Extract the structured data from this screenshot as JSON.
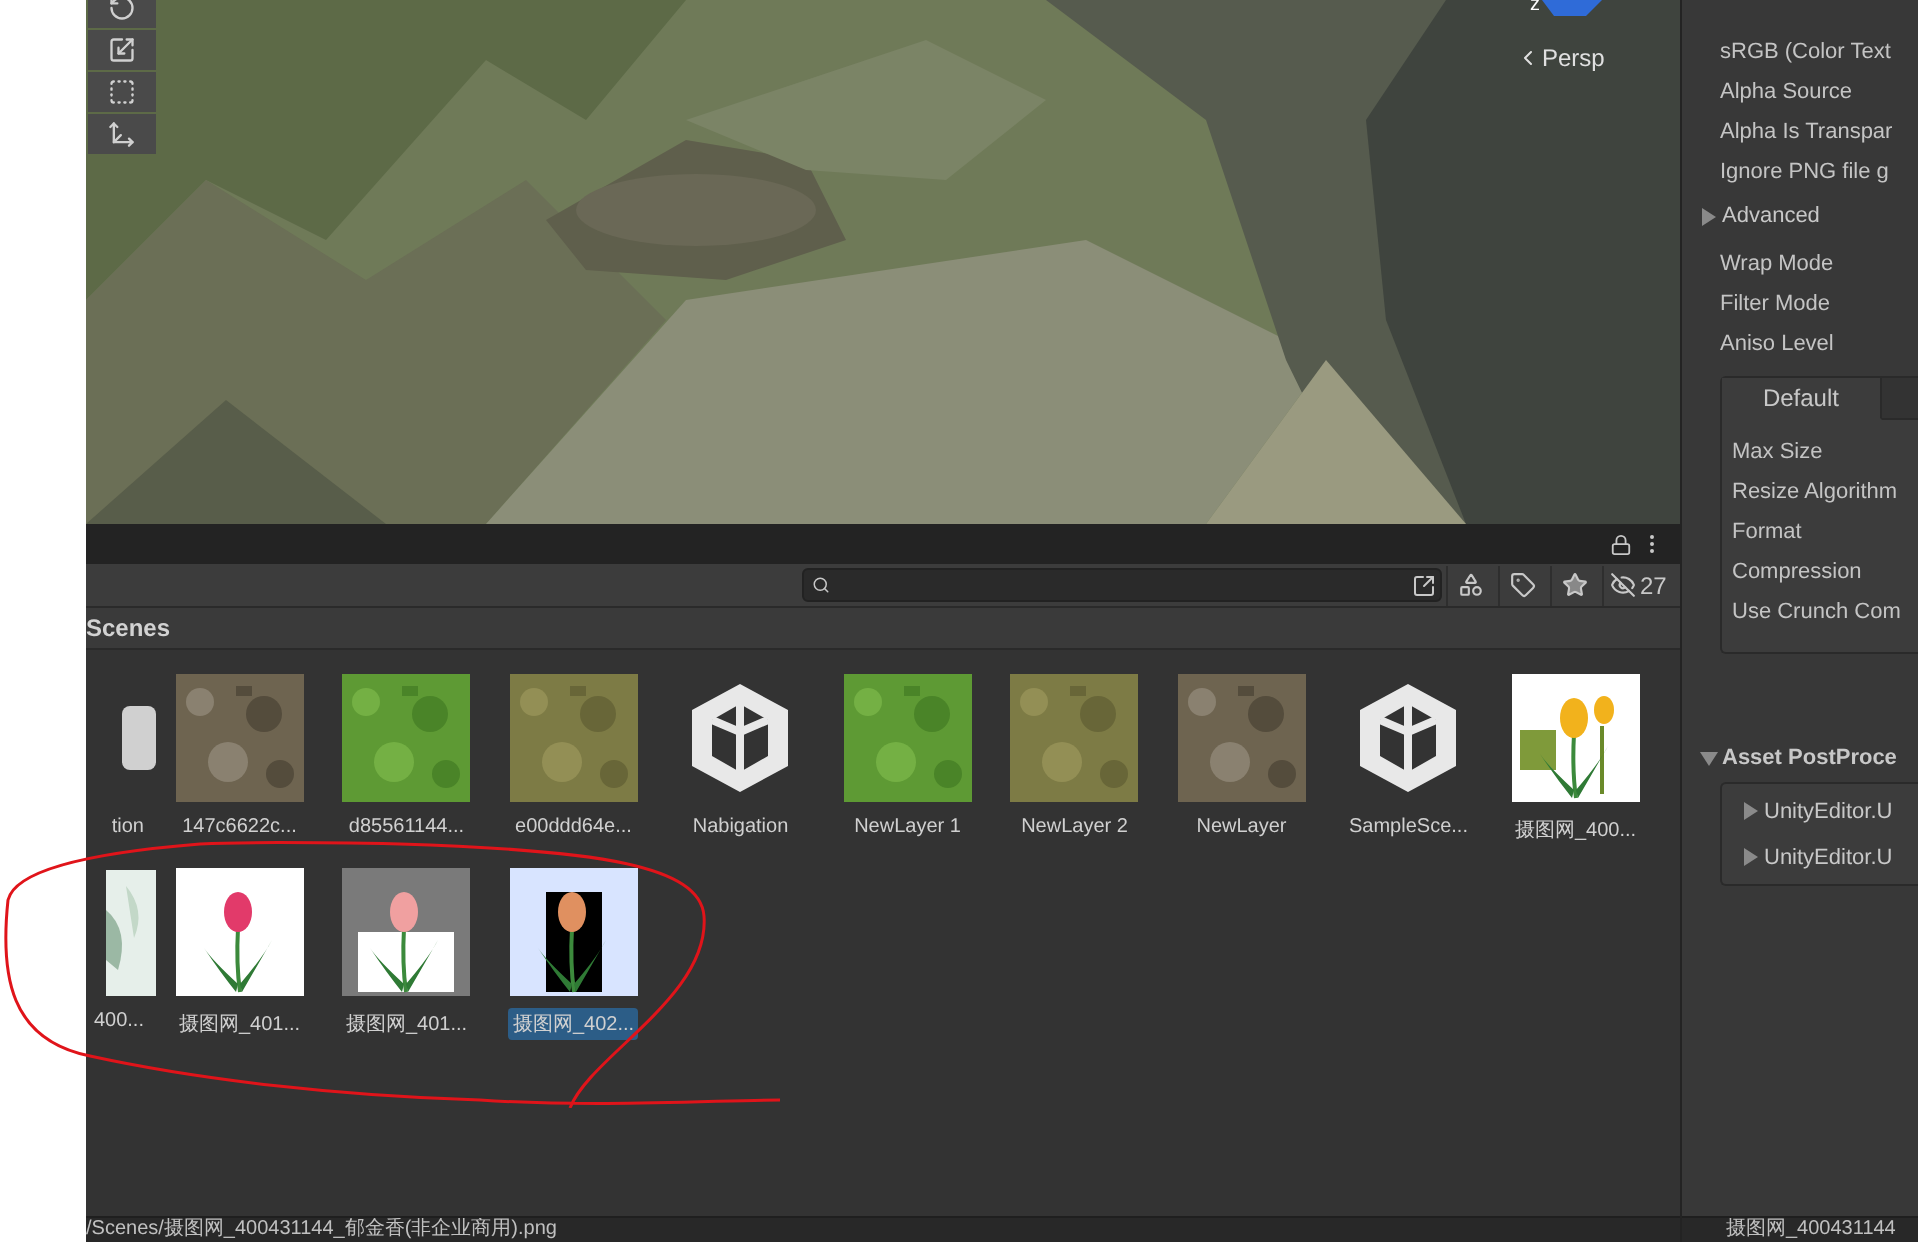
{
  "scene_view": {
    "tools": [
      {
        "kind": "rotate"
      },
      {
        "kind": "scale"
      },
      {
        "kind": "rect"
      },
      {
        "kind": "transform"
      }
    ],
    "gizmo_axis": "z",
    "camera_label": "Persp"
  },
  "project": {
    "hidden_count": "27",
    "breadcrumb": "Scenes",
    "items": [
      {
        "label": "tion",
        "kind": "blank",
        "selected": false
      },
      {
        "label": "147c6622c...",
        "kind": "dirt",
        "selected": false
      },
      {
        "label": "d85561144...",
        "kind": "grass",
        "selected": false
      },
      {
        "label": "e00ddd64e...",
        "kind": "dry",
        "selected": false
      },
      {
        "label": "Nabigation",
        "kind": "unity",
        "selected": false
      },
      {
        "label": "NewLayer 1",
        "kind": "grass",
        "selected": false
      },
      {
        "label": "NewLayer 2",
        "kind": "dry",
        "selected": false
      },
      {
        "label": "NewLayer",
        "kind": "dirt",
        "selected": false
      },
      {
        "label": "SampleSce...",
        "kind": "unity",
        "selected": false
      },
      {
        "label": "摄图网_400...",
        "kind": "tulips-yellow",
        "selected": false
      },
      {
        "label": "400...",
        "kind": "leaves",
        "selected": false
      },
      {
        "label": "摄图网_401...",
        "kind": "tulip-pink",
        "selected": false
      },
      {
        "label": "摄图网_401...",
        "kind": "tulip-gray",
        "selected": false
      },
      {
        "label": "摄图网_402...",
        "kind": "tulips-orange",
        "selected": true
      }
    ],
    "path": "/Scenes/摄图网_400431144_郁金香(非企业商用).png"
  },
  "inspector": {
    "top_rows": [
      "sRGB (Color Text",
      "Alpha Source",
      "Alpha Is Transpar",
      "Ignore PNG file g"
    ],
    "advanced": {
      "label": "Advanced",
      "expanded": false
    },
    "mid_rows": [
      "Wrap Mode",
      "Filter Mode",
      "Aniso Level"
    ],
    "tabs": [
      {
        "label": "Default",
        "selected": true
      },
      {
        "selected": false
      }
    ],
    "platform_rows": [
      "Max Size",
      "Resize Algorithm",
      "Format",
      "Compression",
      "Use Crunch Com"
    ],
    "postprocessors": {
      "label": "Asset PostProce",
      "expanded": true,
      "children": [
        {
          "label": "UnityEditor.U",
          "expanded": false
        },
        {
          "label": "UnityEditor.U",
          "expanded": false
        }
      ]
    },
    "footer": "摄图网_400431144"
  }
}
